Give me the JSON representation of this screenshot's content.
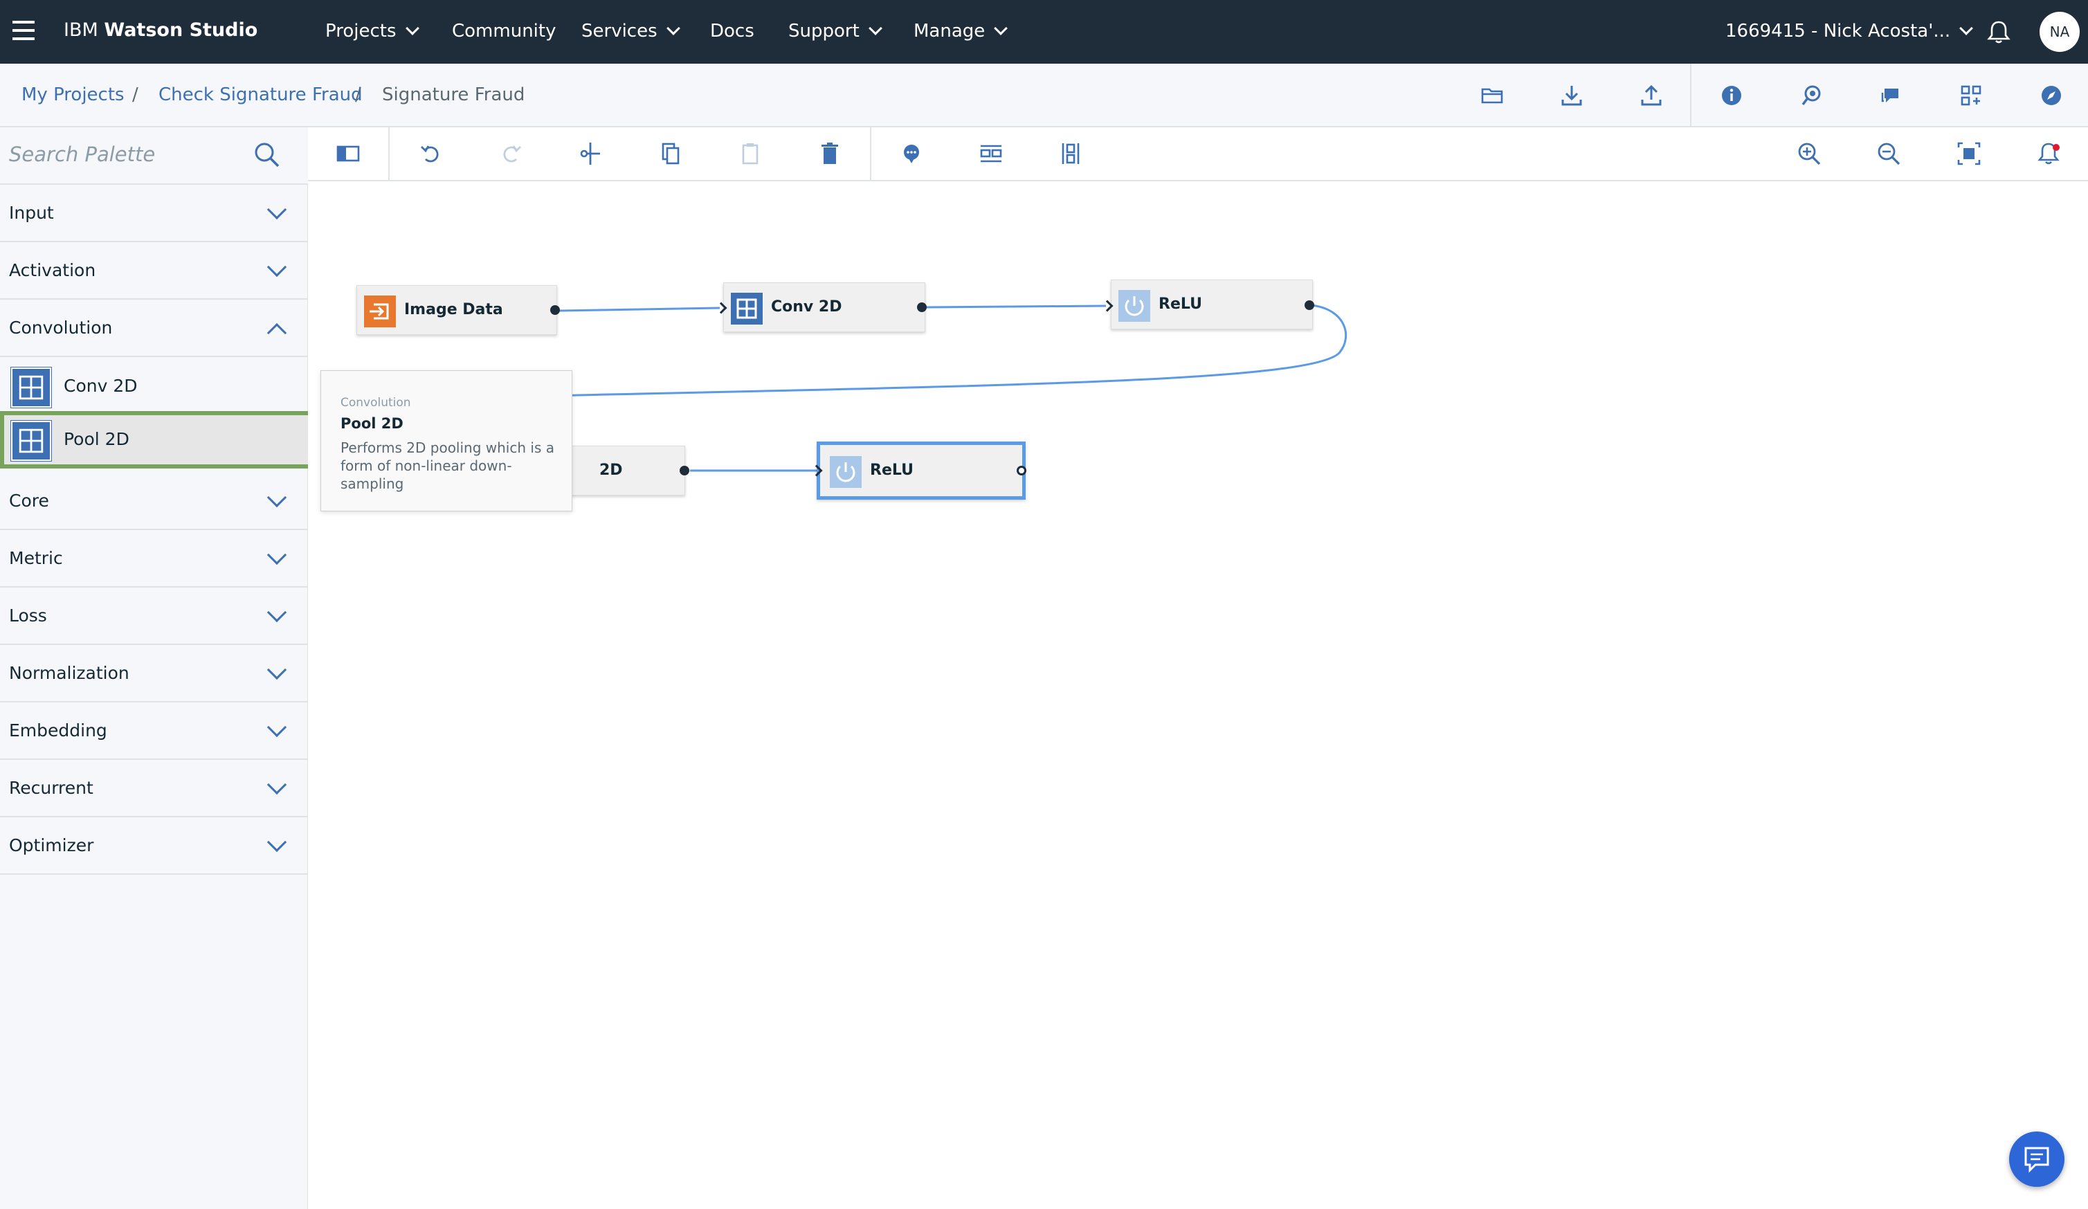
{
  "topnav": {
    "brand_prefix": "IBM ",
    "brand_name": "Watson Studio",
    "items": [
      {
        "label": "Projects"
      },
      {
        "label": "Community"
      },
      {
        "label": "Services"
      },
      {
        "label": "Docs"
      },
      {
        "label": "Support"
      },
      {
        "label": "Manage"
      }
    ],
    "account": "1669415 - Nick Acosta'...",
    "avatar_initials": "NA"
  },
  "breadcrumb": {
    "items": [
      "My Projects",
      "Check Signature Fraud",
      "Signature Fraud"
    ],
    "separator": "/"
  },
  "palette": {
    "search_placeholder": "Search Palette",
    "categories": [
      {
        "label": "Input",
        "expanded": false
      },
      {
        "label": "Activation",
        "expanded": false
      },
      {
        "label": "Convolution",
        "expanded": true
      },
      {
        "label": "Core",
        "expanded": false
      },
      {
        "label": "Metric",
        "expanded": false
      },
      {
        "label": "Loss",
        "expanded": false
      },
      {
        "label": "Normalization",
        "expanded": false
      },
      {
        "label": "Embedding",
        "expanded": false
      },
      {
        "label": "Recurrent",
        "expanded": false
      },
      {
        "label": "Optimizer",
        "expanded": false
      }
    ],
    "convolution_items": [
      {
        "label": "Conv 2D",
        "selected": false
      },
      {
        "label": "Pool 2D",
        "selected": true
      }
    ]
  },
  "canvas": {
    "nodes": [
      {
        "label": "Image Data",
        "icon": "import-icon"
      },
      {
        "label": "Conv 2D",
        "icon": "grid-icon"
      },
      {
        "label": "ReLU",
        "icon": "power-icon"
      },
      {
        "label": "2D",
        "icon": "grid-icon"
      },
      {
        "label": "ReLU",
        "icon": "power-icon",
        "selected": true
      }
    ]
  },
  "tooltip": {
    "category": "Convolution",
    "title": "Pool 2D",
    "description": "Performs 2D pooling which is a form of non-linear down-sampling"
  },
  "colors": {
    "nav_bg": "#1f2d3a",
    "accent": "#3d70b2",
    "selection_border": "#78a35a",
    "input_node": "#e8782e"
  }
}
